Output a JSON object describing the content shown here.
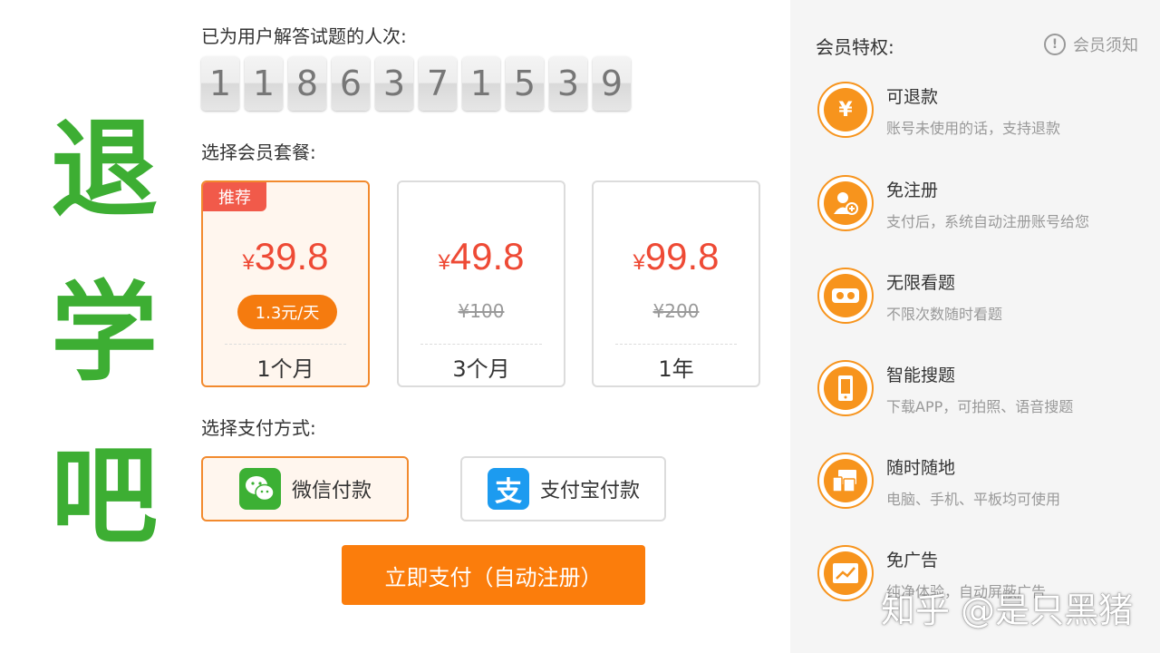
{
  "overlay": {
    "chars": [
      "退",
      "学",
      "吧"
    ]
  },
  "counter": {
    "label": "已为用户解答试题的人次:",
    "digits": [
      "1",
      "1",
      "8",
      "6",
      "3",
      "7",
      "1",
      "5",
      "3",
      "9"
    ]
  },
  "plans": {
    "label": "选择会员套餐:",
    "items": [
      {
        "badge": "推荐",
        "currency": "¥",
        "price": "39.8",
        "per_day": "1.3元/天",
        "duration": "1个月",
        "selected": true
      },
      {
        "currency": "¥",
        "price": "49.8",
        "original": "¥100",
        "duration": "3个月",
        "selected": false
      },
      {
        "currency": "¥",
        "price": "99.8",
        "original": "¥200",
        "duration": "1年",
        "selected": false
      }
    ]
  },
  "payment": {
    "label": "选择支付方式:",
    "wechat": "微信付款",
    "alipay_glyph": "支",
    "alipay": "支付宝付款",
    "pay_button": "立即支付（自动注册）"
  },
  "side": {
    "title": "会员特权:",
    "notice": "会员须知",
    "notice_glyph": "!",
    "privileges": [
      {
        "icon": "yen-icon",
        "glyph": "¥",
        "title": "可退款",
        "desc": "账号未使用的话，支持退款"
      },
      {
        "icon": "user-add-icon",
        "glyph": "",
        "title": "免注册",
        "desc": "支付后，系统自动注册账号给您"
      },
      {
        "icon": "eyes-icon",
        "glyph": "",
        "title": "无限看题",
        "desc": "不限次数随时看题"
      },
      {
        "icon": "phone-icon",
        "glyph": "",
        "title": "智能搜题",
        "desc": "下载APP，可拍照、语音搜题"
      },
      {
        "icon": "devices-icon",
        "glyph": "",
        "title": "随时随地",
        "desc": "电脑、手机、平板均可使用"
      },
      {
        "icon": "chart-icon",
        "glyph": "",
        "title": "免广告",
        "desc": "纯净体验，自动屏蔽广告"
      }
    ]
  },
  "watermark": "知乎 @是只黑猪",
  "colors": {
    "accent": "#fb7d0c",
    "price": "#ee4a35",
    "overlay_green": "#3dae33",
    "badge": "#f15a4a"
  }
}
